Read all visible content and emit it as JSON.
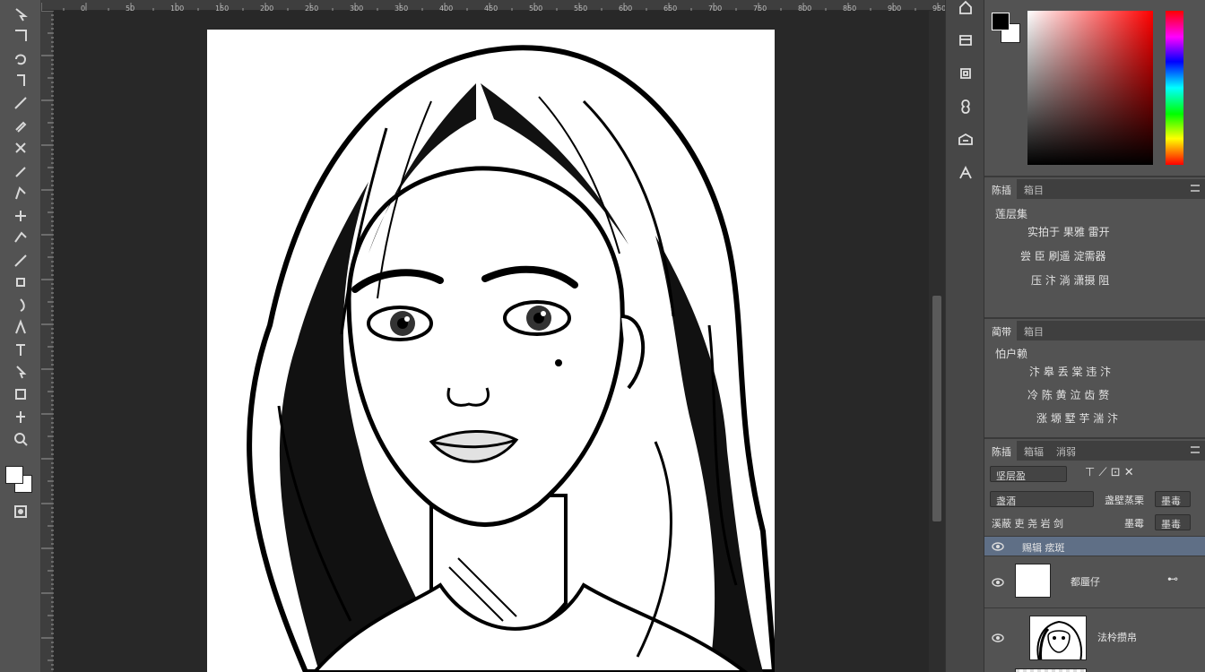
{
  "toolbar": {
    "tools": [
      "move-tool",
      "marquee-tool",
      "lasso-tool",
      "quick-select-tool",
      "crop-tool",
      "eyedropper-tool",
      "healing-brush-tool",
      "brush-tool",
      "clone-stamp-tool",
      "history-brush-tool",
      "eraser-tool",
      "gradient-tool",
      "blur-tool",
      "dodge-tool",
      "pen-tool",
      "type-tool",
      "path-select-tool",
      "shape-tool",
      "hand-tool",
      "zoom-tool"
    ],
    "foreground_color": "#ffffff",
    "background_color": "#ffffff"
  },
  "ruler": {
    "top_marks": [
      "0",
      "50",
      "100",
      "150",
      "200",
      "250",
      "300",
      "350",
      "400",
      "450",
      "500",
      "550",
      "600",
      "650",
      "700",
      "750",
      "800",
      "850",
      "900",
      "950"
    ]
  },
  "canvas": {
    "background": "#282828",
    "artboard_color": "#ffffff",
    "image_subject": "line-art-portrait"
  },
  "icon_strip": {
    "buttons": [
      "home-icon",
      "history-icon",
      "swatches-icon",
      "properties-icon",
      "libraries-icon",
      "adjustments-icon"
    ]
  },
  "color_panel": {
    "foreground": "#000000",
    "background": "#ffffff",
    "hue": "#ff0000"
  },
  "panel2": {
    "tabs": [
      "陈插",
      "箱目"
    ],
    "title": "莲层集",
    "lines": [
      "实拍于 果雅 雷开",
      "尝 臣 刷遥 淀需器",
      "压 汴 淌 潇摄 阻"
    ]
  },
  "panel3": {
    "tabs": [
      "蔺带",
      "箱目"
    ],
    "title": "怕户赖",
    "lines": [
      "汴 皋 丢 棠 违 汴",
      "冷 陈 黄 泣 齿 赘",
      "涨 塬 墅 芋 湍 汴"
    ]
  },
  "layers_panel": {
    "tabs": [
      "陈插",
      "箱辐",
      "消弱"
    ],
    "kind_filter": "坚层盈",
    "blend_mode": "盏酒",
    "opacity_label": "盏壁蒸栗",
    "opacity_value": "墨毒",
    "fill_label": "墨霉",
    "fill_value": "墨毒",
    "lock_label": "溪蔽 吏 尧 岩 剑",
    "layers": [
      {
        "name": "赐辑 痃斑",
        "selected": true
      },
      {
        "name": "都蜃仔",
        "selected": false
      },
      {
        "name": "法柃攒帛",
        "selected": false
      }
    ]
  }
}
